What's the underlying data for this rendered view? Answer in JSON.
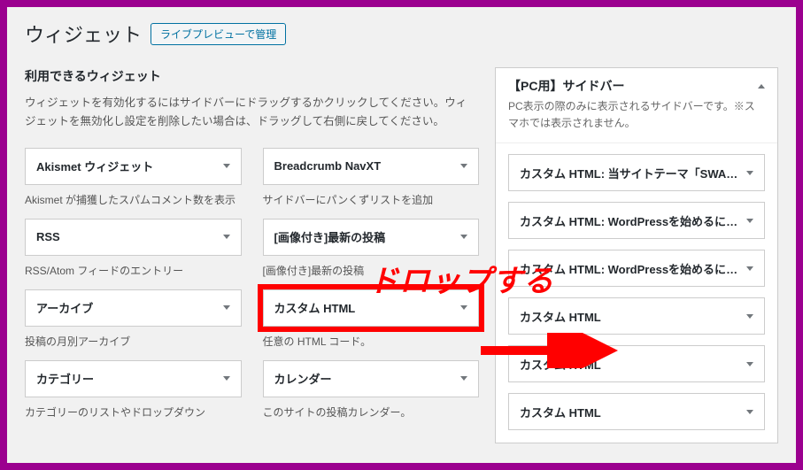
{
  "header": {
    "title": "ウィジェット",
    "live_preview_label": "ライブプレビューで管理"
  },
  "available": {
    "heading": "利用できるウィジェット",
    "description": "ウィジェットを有効化するにはサイドバーにドラッグするかクリックしてください。ウィジェットを無効化し設定を削除したい場合は、ドラッグして右側に戻してください。",
    "widgets": [
      {
        "name": "Akismet ウィジェット",
        "desc": "Akismet が捕獲したスパムコメント数を表示",
        "highlight": false
      },
      {
        "name": "Breadcrumb NavXT",
        "desc": "サイドバーにパンくずリストを追加",
        "highlight": false
      },
      {
        "name": "RSS",
        "desc": "RSS/Atom フィードのエントリー",
        "highlight": false
      },
      {
        "name": "[画像付き]最新の投稿",
        "desc": "[画像付き]最新の投稿",
        "highlight": false
      },
      {
        "name": "アーカイブ",
        "desc": "投稿の月別アーカイブ",
        "highlight": false
      },
      {
        "name": "カスタム HTML",
        "desc": "任意の HTML コード。",
        "highlight": true
      },
      {
        "name": "カテゴリー",
        "desc": "カテゴリーのリストやドロップダウン",
        "highlight": false
      },
      {
        "name": "カレンダー",
        "desc": "このサイトの投稿カレンダー。",
        "highlight": false
      }
    ]
  },
  "sidebar_area": {
    "title": "【PC用】サイドバー",
    "description": "PC表示の際のみに表示されるサイドバーです。※スマホでは表示されません。",
    "items": [
      {
        "label": "カスタム HTML: 当サイトテーマ「SWALLO..."
      },
      {
        "label": "カスタム HTML: WordPressを始めるにはド..."
      },
      {
        "label": "カスタム HTML: WordPressを始めるにはサ..."
      },
      {
        "label": "カスタム HTML"
      },
      {
        "label": "カスタム HTML"
      },
      {
        "label": "カスタム HTML"
      }
    ]
  },
  "annotation": {
    "text": "ドロップする"
  }
}
